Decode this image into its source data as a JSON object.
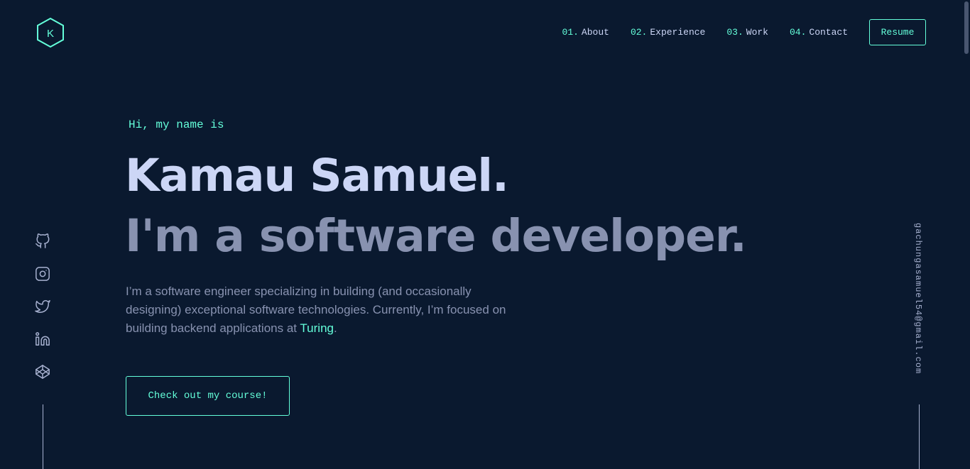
{
  "logo": {
    "letter": "K",
    "icon": "hexagon-logo-icon"
  },
  "nav": {
    "items": [
      {
        "num": "01.",
        "label": "About"
      },
      {
        "num": "02.",
        "label": "Experience"
      },
      {
        "num": "03.",
        "label": "Work"
      },
      {
        "num": "04.",
        "label": "Contact"
      }
    ],
    "resume_label": "Resume"
  },
  "hero": {
    "greeting": "Hi, my name is",
    "name": "Kamau Samuel.",
    "tagline": "I'm a software developer.",
    "intro_text": "I’m a software engineer specializing in building (and occasionally designing) exceptional software technologies. Currently, I’m focused on building backend applications at ",
    "intro_link": "Turing",
    "intro_end": ".",
    "cta_label": "Check out my course!"
  },
  "social": {
    "icons": [
      "github-icon",
      "instagram-icon",
      "twitter-icon",
      "linkedin-icon",
      "codepen-icon"
    ]
  },
  "email": "gachungasamuel54@gmail.com",
  "colors": {
    "background": "#0a192f",
    "accent": "#64ffda",
    "heading": "#ccd6f6",
    "text": "#8892b0"
  }
}
